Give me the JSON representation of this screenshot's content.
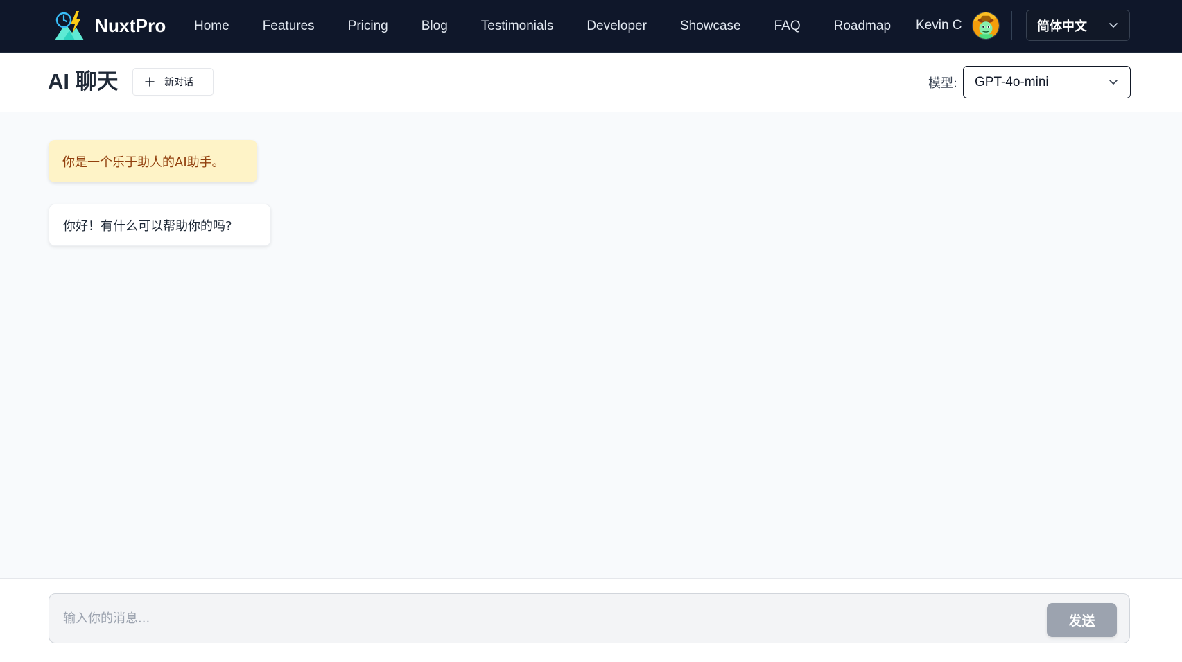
{
  "header": {
    "brand_name": "NuxtPro",
    "nav_links": [
      {
        "label": "Home"
      },
      {
        "label": "Features"
      },
      {
        "label": "Pricing"
      },
      {
        "label": "Blog"
      },
      {
        "label": "Testimonials"
      },
      {
        "label": "Developer"
      },
      {
        "label": "Showcase"
      },
      {
        "label": "FAQ"
      },
      {
        "label": "Roadmap"
      }
    ],
    "user_name": "Kevin C",
    "language": "简体中文"
  },
  "chat": {
    "title": "AI 聊天",
    "new_chat_label": "新对话",
    "model_label": "模型:",
    "model_value": "GPT-4o-mini"
  },
  "messages": [
    {
      "role": "system",
      "text": "你是一个乐于助人的AI助手。"
    },
    {
      "role": "assistant",
      "text": "你好！有什么可以帮助你的吗?"
    }
  ],
  "composer": {
    "placeholder": "输入你的消息...",
    "value": "",
    "send_label": "发送"
  },
  "theme": {
    "nav_bg": "#0f172a",
    "system_bubble_bg": "#fef3c7",
    "system_bubble_text": "#92400e",
    "send_button_disabled": "#9ca3af"
  },
  "icons": {
    "brand": "clock-lightning-mountain-logo",
    "language_dropdown": "chevron-down-icon",
    "model_dropdown": "chevron-down-icon",
    "new_chat": "plus-icon",
    "avatar": "user-avatar"
  }
}
